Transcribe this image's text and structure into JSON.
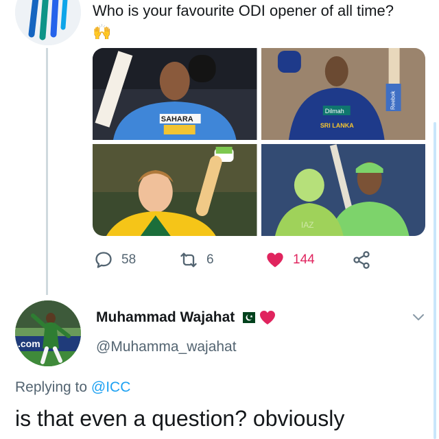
{
  "tweet": {
    "text": "Who is your favourite ODI opener of all time?",
    "emoji": "🙌",
    "author_avatar_icon": "icc-logo-icon",
    "media": [
      {
        "name": "photo-sachin",
        "jersey_text": "SAHARA"
      },
      {
        "name": "photo-jayasuriya",
        "jersey_text": "Dilmah",
        "jersey_subtext": "SRI LANKA",
        "bat_text": "Reebok"
      },
      {
        "name": "photo-gilchrist"
      },
      {
        "name": "photo-anwar"
      }
    ],
    "stats": {
      "replies": "58",
      "retweets": "6",
      "likes": "144"
    },
    "liked": true
  },
  "reply": {
    "display_name": "Muhammad Wajahat",
    "handle": "@Muhamma_wajahat",
    "replying_to_prefix": "Replying to",
    "replying_to_mention": "@ICC",
    "text": "is that even a question? obviously",
    "avatar_banner_text": ".com"
  },
  "colors": {
    "like": "#e0245e",
    "link": "#1da1f2",
    "secondary_text": "#536471",
    "thread_line": "#cfd9de"
  }
}
